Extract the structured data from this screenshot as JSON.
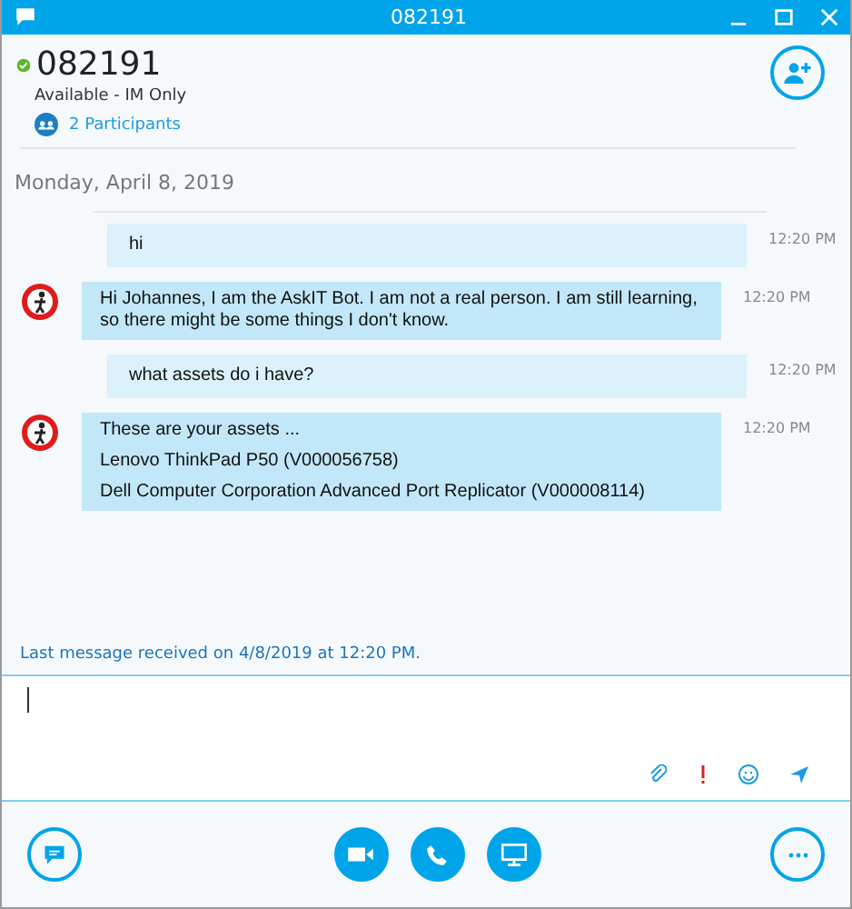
{
  "window": {
    "title": "082191"
  },
  "contact": {
    "name": "082191",
    "status": "Available - IM Only",
    "participants": "2 Participants"
  },
  "date": "Monday, April 8, 2019",
  "messages": [
    {
      "kind": "sent",
      "lines": [
        "hi"
      ],
      "time": "12:20 PM"
    },
    {
      "kind": "received",
      "lines": [
        "Hi Johannes, I am the AskIT Bot. I am not a real person. I am still learning, so there might be some things I don't know."
      ],
      "time": "12:20 PM"
    },
    {
      "kind": "sent",
      "lines": [
        "what assets do i have?"
      ],
      "time": "12:20 PM"
    },
    {
      "kind": "received",
      "lines": [
        "These are your assets ...",
        "Lenovo ThinkPad P50 (V000056758)",
        "Dell Computer Corporation Advanced Port Replicator (V000008114)"
      ],
      "time": "12:20 PM"
    }
  ],
  "status_line": "Last message received on 4/8/2019 at 12:20 PM."
}
